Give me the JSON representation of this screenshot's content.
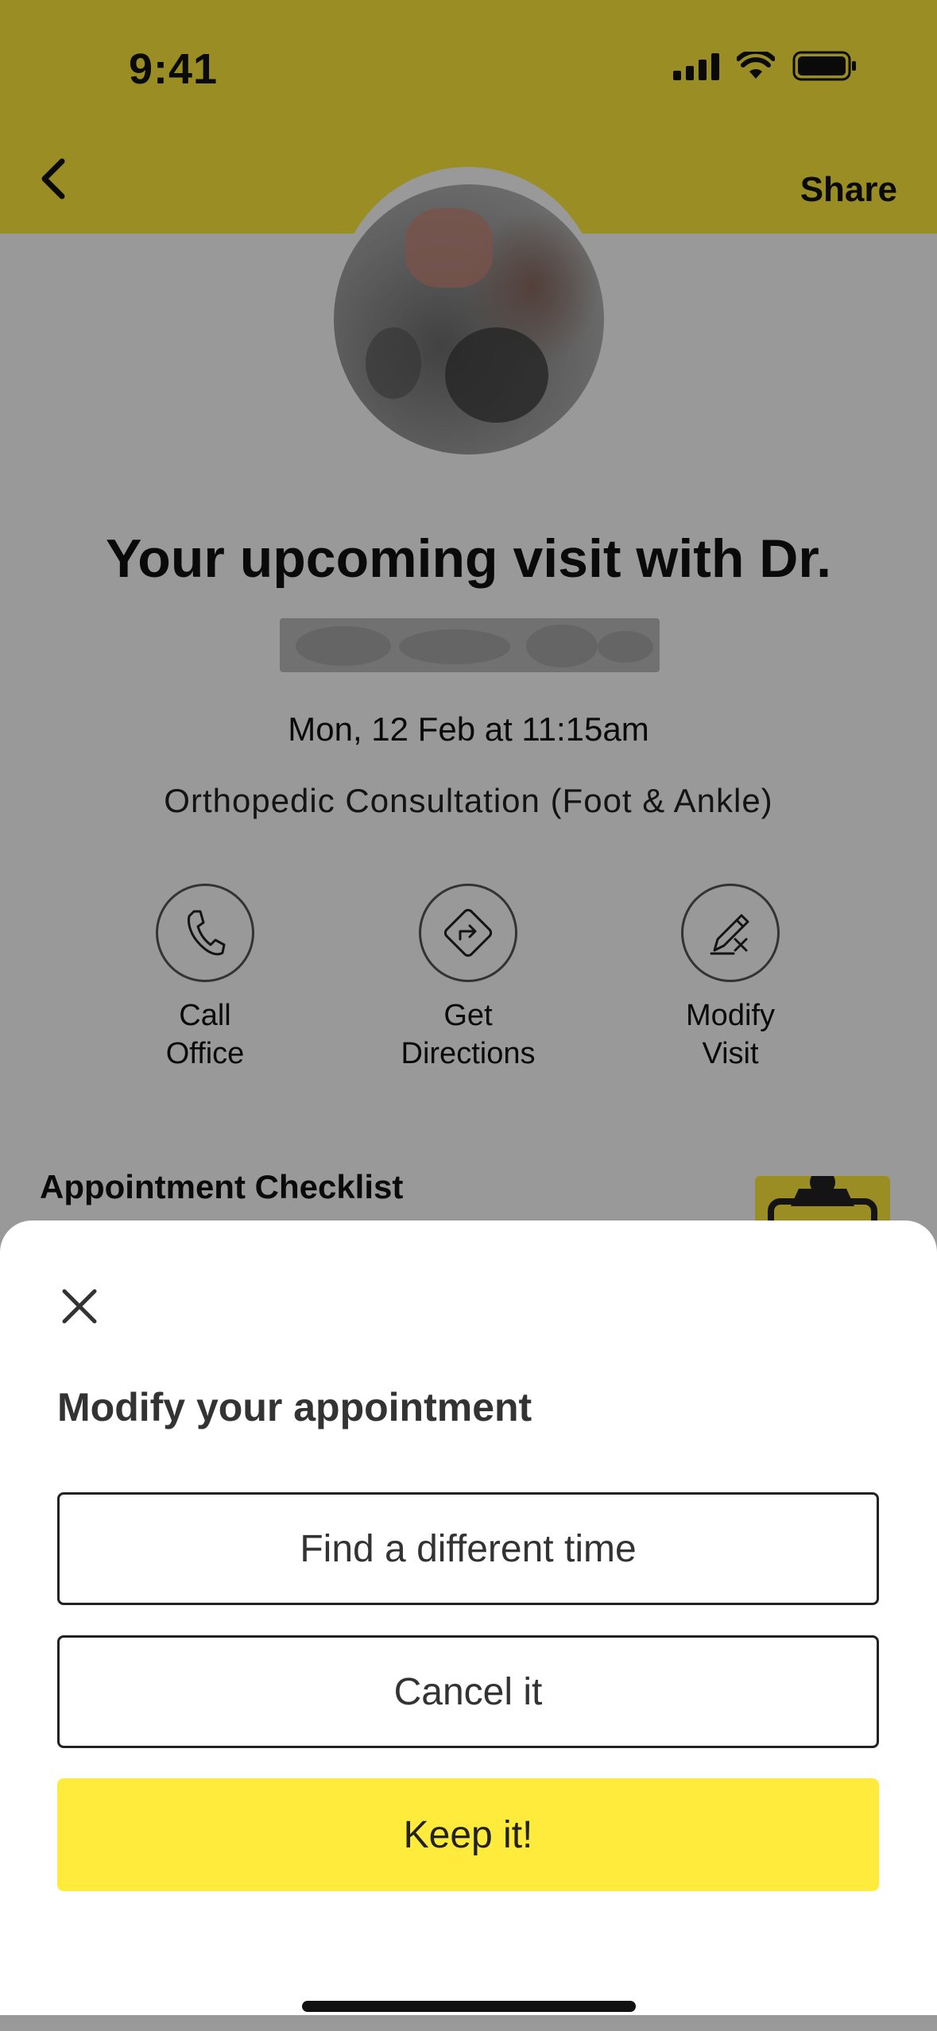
{
  "colors": {
    "brand": "#FFEB3B",
    "accent": "#FFEB3B"
  },
  "status_bar": {
    "time": "9:41"
  },
  "header": {
    "back_icon": "chevron-left-icon",
    "share_label": "Share"
  },
  "appointment": {
    "title": "Your upcoming visit with Dr.",
    "date": "Mon, 12 Feb at 11:15am",
    "visit_type": "Orthopedic Consultation (Foot & Ankle)"
  },
  "actions": [
    {
      "label": "Call\nOffice",
      "icon": "phone-icon"
    },
    {
      "label": "Get\nDirections",
      "icon": "directions-icon"
    },
    {
      "label": "Modify\nVisit",
      "icon": "edit-icon"
    }
  ],
  "checklist": {
    "title": "Appointment Checklist",
    "icon": "clipboard-icon"
  },
  "sheet": {
    "close_icon": "close-icon",
    "title": "Modify your appointment",
    "find_label": "Find a different time",
    "cancel_label": "Cancel it",
    "keep_label": "Keep it!"
  }
}
